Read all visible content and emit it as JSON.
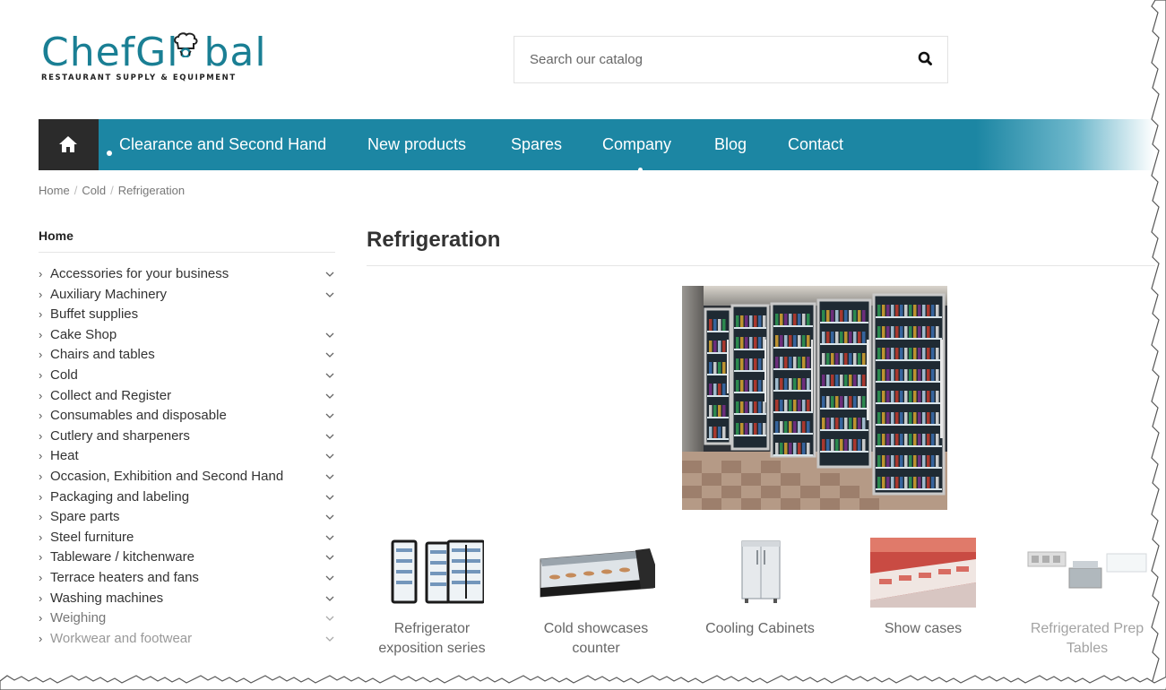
{
  "brand": {
    "name_part1": "Chef",
    "name_part2": "Gl",
    "name_part3": "bal",
    "tagline": "RESTAURANT SUPPLY & EQUIPMENT",
    "accent_color": "#1a7f94"
  },
  "search": {
    "placeholder": "Search our catalog",
    "icon": "search-icon"
  },
  "nav": {
    "home_icon": "home-icon",
    "items": [
      "Clearance and Second Hand",
      "New products",
      "Spares",
      "Company",
      "Blog",
      "Contact"
    ],
    "bar_color": "#1c86a3"
  },
  "breadcrumb": [
    "Home",
    "Cold",
    "Refrigeration"
  ],
  "sidebar": {
    "title": "Home",
    "items": [
      "Accessories for your business",
      "Auxiliary Machinery",
      "Buffet supplies",
      "Cake Shop",
      "Chairs and tables",
      "Cold",
      "Collect and Register",
      "Consumables and disposable",
      "Cutlery and sharpeners",
      "Heat",
      "Occasion, Exhibition and Second Hand",
      "Packaging and labeling",
      "Spare parts",
      "Steel furniture",
      "Tableware / kitchenware",
      "Terrace heaters and fans",
      "Washing machines",
      "Weighing",
      "Workwear and footwear"
    ]
  },
  "main": {
    "title": "Refrigeration",
    "subcategories": [
      {
        "line1": "Refrigerator",
        "line2": "exposition series"
      },
      {
        "line1": "Cold showcases",
        "line2": "counter"
      },
      {
        "line1": "Cooling Cabinets",
        "line2": ""
      },
      {
        "line1": "Show cases",
        "line2": ""
      },
      {
        "line1": "Refrigerated Prep",
        "line2": "Tables"
      }
    ]
  }
}
